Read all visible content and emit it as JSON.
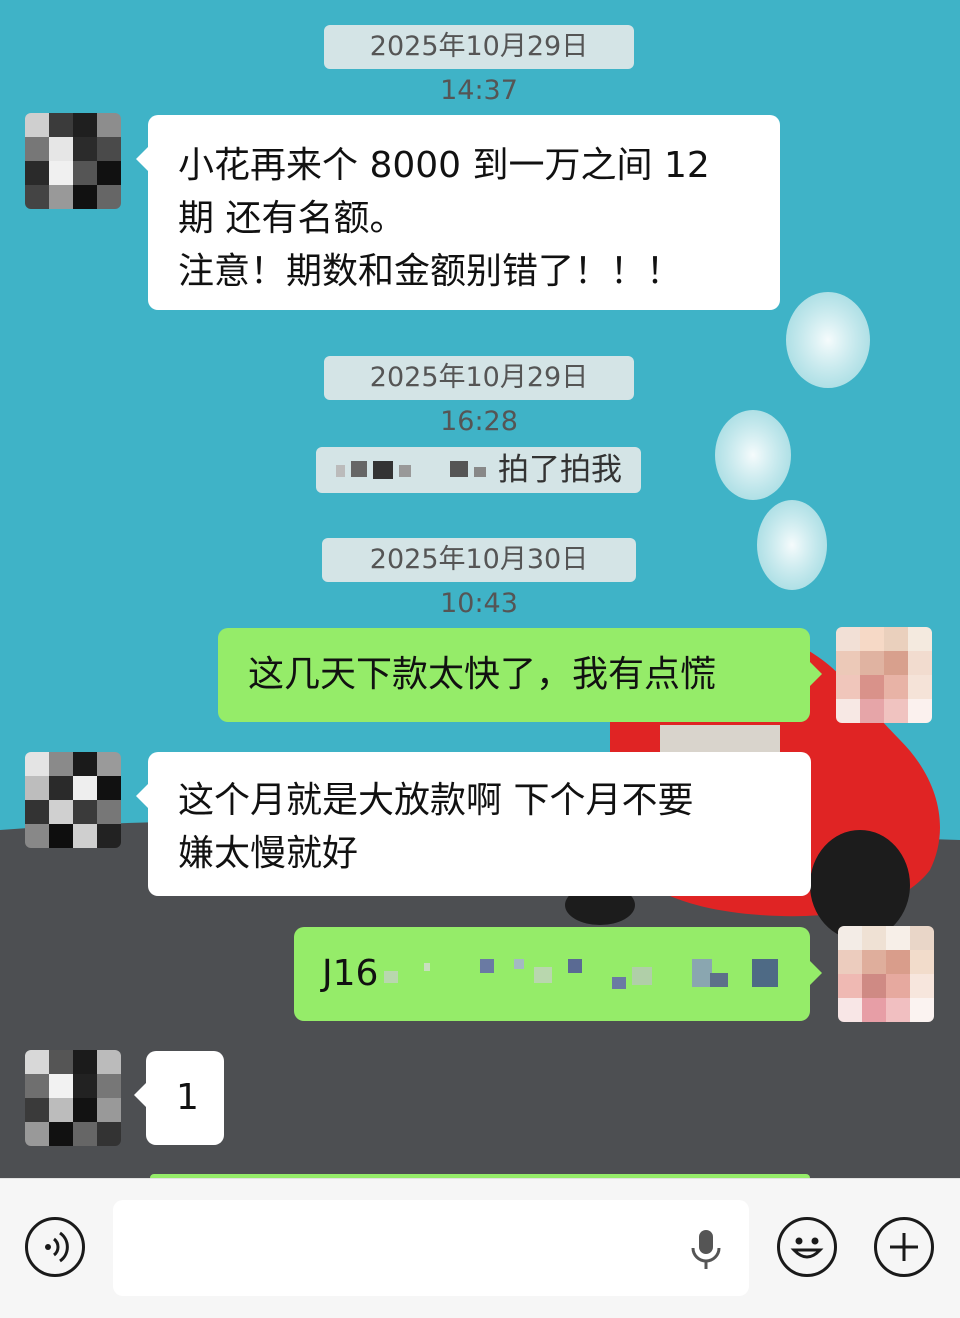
{
  "messages": {
    "ts1": "2025年10月29日 14:37",
    "msg1_line1": "小花再来个 8000 到一万之间 12",
    "msg1_line2": "期 还有名额。",
    "msg1_line3": "注意！期数和金额别错了！！！",
    "ts2": "2025年10月29日 16:28",
    "pat_text": "拍了拍我",
    "ts3": "2025年10月30日 10:43",
    "msg2": "这几天下款太快了，我有点慌",
    "msg3_line1": "这个月就是大放款啊 下个月不要",
    "msg3_line2": "嫌太慢就好",
    "msg4_prefix": "J16",
    "msg5": "1"
  },
  "icons": {
    "voice": "voice-input-icon",
    "mic": "microphone-icon",
    "emoji": "emoji-icon",
    "add": "plus-icon"
  },
  "colors": {
    "outgoing_bubble": "#95ec69",
    "incoming_bubble": "#ffffff",
    "sky": "#3fb3c7"
  }
}
